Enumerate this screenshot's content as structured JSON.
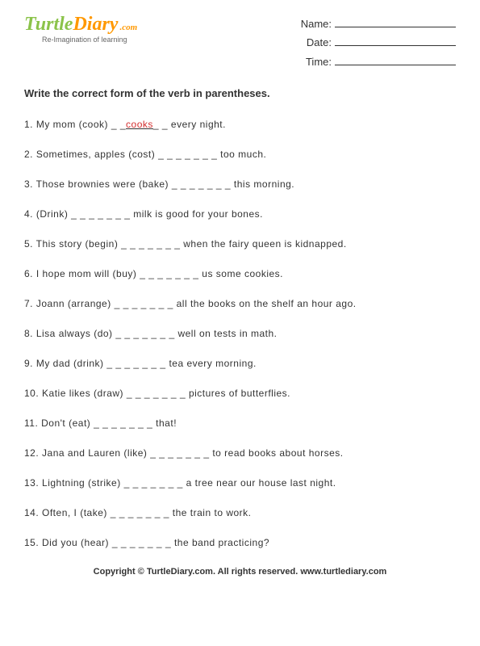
{
  "logo": {
    "part1": "Turtle",
    "part2": "Diary",
    "dotcom": ".com",
    "tagline": "Re-Imagination of learning"
  },
  "fields": {
    "name_label": "Name:",
    "date_label": "Date:",
    "time_label": "Time:"
  },
  "instructions": "Write the correct form of the verb in parentheses.",
  "blank": "_ _ _ _ _ _ _",
  "blank_short": "_ _",
  "example_answer": "cooks",
  "questions": [
    {
      "num": "1.",
      "before": "My mom (cook) ",
      "example": true,
      "after": " every night."
    },
    {
      "num": "2.",
      "before": "Sometimes, apples (cost) ",
      "after": " too much."
    },
    {
      "num": "3.",
      "before": "Those brownies were (bake) ",
      "after": " this morning."
    },
    {
      "num": "4.",
      "before": "(Drink) ",
      "after": " milk is good for your bones."
    },
    {
      "num": "5.",
      "before": "This story (begin) ",
      "after": " when the fairy queen is kidnapped."
    },
    {
      "num": "6.",
      "before": "I hope mom will (buy) ",
      "after": " us some cookies."
    },
    {
      "num": "7.",
      "before": "Joann (arrange) ",
      "after": " all the books on the shelf an hour ago."
    },
    {
      "num": "8.",
      "before": "Lisa always (do) ",
      "after": " well on tests in math."
    },
    {
      "num": "9.",
      "before": "My dad (drink) ",
      "after": " tea every morning."
    },
    {
      "num": "10.",
      "before": "Katie likes (draw) ",
      "after": " pictures of butterflies."
    },
    {
      "num": "11.",
      "before": "Don't (eat) ",
      "after": " that!"
    },
    {
      "num": "12.",
      "before": "Jana and Lauren (like) ",
      "after": " to read books about horses."
    },
    {
      "num": "13.",
      "before": "Lightning (strike) ",
      "after": " a tree near our house last night."
    },
    {
      "num": "14.",
      "before": "Often, I (take) ",
      "after": " the train to work."
    },
    {
      "num": "15.",
      "before": "Did you (hear) ",
      "after": " the band practicing?"
    }
  ],
  "footer": "Copyright © TurtleDiary.com. All rights reserved. www.turtlediary.com"
}
